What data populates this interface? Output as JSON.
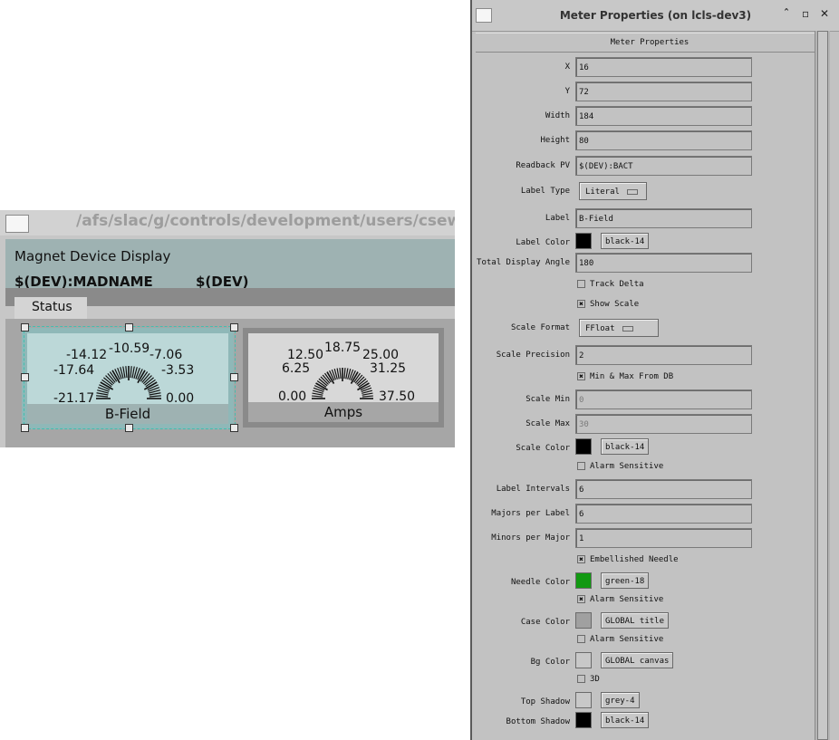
{
  "display": {
    "title": "/afs/slac/g/controls/development/users/csewell/sa",
    "header_title": "Magnet Device Display",
    "pv_left": "$(DEV):MADNAME",
    "pv_right": "$(DEV)",
    "tab_label": "Status",
    "meter_bfield": {
      "label": "B-Field",
      "scale_labels": [
        "-21.17",
        "-17.64",
        "-14.12",
        "-10.59",
        "-7.06",
        "-3.53",
        "0.00"
      ]
    },
    "meter_amps": {
      "label": "Amps",
      "scale_labels": [
        "0.00",
        "6.25",
        "12.50",
        "18.75",
        "25.00",
        "31.25",
        "37.50"
      ]
    }
  },
  "properties": {
    "window_title": "Meter Properties (on lcls-dev3)",
    "title_buttons": [
      "ˆ",
      "▫",
      "✕"
    ],
    "section_header": "Meter Properties",
    "fields": [
      {
        "label": "X",
        "value": "16"
      },
      {
        "label": "Y",
        "value": "72"
      },
      {
        "label": "Width",
        "value": "184"
      },
      {
        "label": "Height",
        "value": "80"
      },
      {
        "label": "Readback PV",
        "value": "$(DEV):BACT"
      }
    ],
    "label_type": {
      "label": "Label Type",
      "value": "Literal"
    },
    "label": {
      "label": "Label",
      "value": "B-Field"
    },
    "label_color": {
      "label": "Label Color",
      "value": "black-14",
      "color": "#000000"
    },
    "total_angle": {
      "label": "Total Display Angle",
      "value": "180"
    },
    "track_delta": {
      "label": "Track Delta",
      "checked": false
    },
    "show_scale": {
      "label": "Show Scale",
      "checked": true
    },
    "scale_format": {
      "label": "Scale Format",
      "value": "FFloat"
    },
    "scale_precision": {
      "label": "Scale Precision",
      "value": "2"
    },
    "min_max_db": {
      "label": "Min & Max From DB",
      "checked": true
    },
    "scale_min": {
      "label": "Scale Min",
      "value": "0"
    },
    "scale_max": {
      "label": "Scale Max",
      "value": "30"
    },
    "scale_color": {
      "label": "Scale Color",
      "value": "black-14",
      "color": "#000000"
    },
    "scale_alarm": {
      "label": "Alarm Sensitive",
      "checked": false
    },
    "label_intervals": {
      "label": "Label Intervals",
      "value": "6"
    },
    "majors_per_label": {
      "label": "Majors per Label",
      "value": "6"
    },
    "minors_per_major": {
      "label": "Minors per Major",
      "value": "1"
    },
    "embellished": {
      "label": "Embellished Needle",
      "checked": true
    },
    "needle_color": {
      "label": "Needle Color",
      "value": "green-18",
      "color": "#119911"
    },
    "needle_alarm": {
      "label": "Alarm Sensitive",
      "checked": true
    },
    "case_color": {
      "label": "Case Color",
      "value": "GLOBAL title",
      "color": "#a0a0a0"
    },
    "case_alarm": {
      "label": "Alarm Sensitive",
      "checked": false
    },
    "bg_color": {
      "label": "Bg Color",
      "value": "GLOBAL canvas",
      "color": "#c8c8c8"
    },
    "three_d": {
      "label": "3D",
      "checked": false
    },
    "top_shadow": {
      "label": "Top Shadow",
      "value": "grey-4",
      "color": "#c8c8c8"
    },
    "bottom_shadow": {
      "label": "Bottom Shadow",
      "value": "black-14",
      "color": "#000000"
    }
  }
}
